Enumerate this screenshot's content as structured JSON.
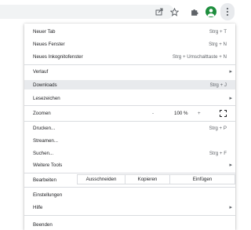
{
  "toolbar": {
    "icons": [
      "share-icon",
      "bookmark-star-icon",
      "extensions-puzzle-icon",
      "profile-avatar",
      "kebab-menu-icon"
    ]
  },
  "menu": {
    "new_tab": {
      "label": "Neuer Tab",
      "shortcut": "Strg + T"
    },
    "new_window": {
      "label": "Neues Fenster",
      "shortcut": "Strg + N"
    },
    "new_incognito": {
      "label": "Neues Inkognitofenster",
      "shortcut": "Strg + Umschalttaste + N"
    },
    "history": {
      "label": "Verlauf"
    },
    "downloads": {
      "label": "Downloads",
      "shortcut": "Strg + J"
    },
    "bookmarks": {
      "label": "Lesezeichen"
    },
    "zoom": {
      "label": "Zoomen",
      "minus": "-",
      "value": "100 %",
      "plus": "+"
    },
    "print": {
      "label": "Drucken...",
      "shortcut": "Strg + P"
    },
    "cast": {
      "label": "Streamen..."
    },
    "find": {
      "label": "Suchen...",
      "shortcut": "Strg + F"
    },
    "more_tools": {
      "label": "Weitere Tools"
    },
    "edit": {
      "label": "Bearbeiten",
      "cut": "Ausschneiden",
      "copy": "Kopieren",
      "paste": "Einfügen"
    },
    "settings": {
      "label": "Einstellungen"
    },
    "help": {
      "label": "Hilfe"
    },
    "exit": {
      "label": "Beenden"
    }
  },
  "colors": {
    "highlight": "#e8eaed",
    "avatar": "#1e8e3e",
    "separator": "#dadce0"
  }
}
